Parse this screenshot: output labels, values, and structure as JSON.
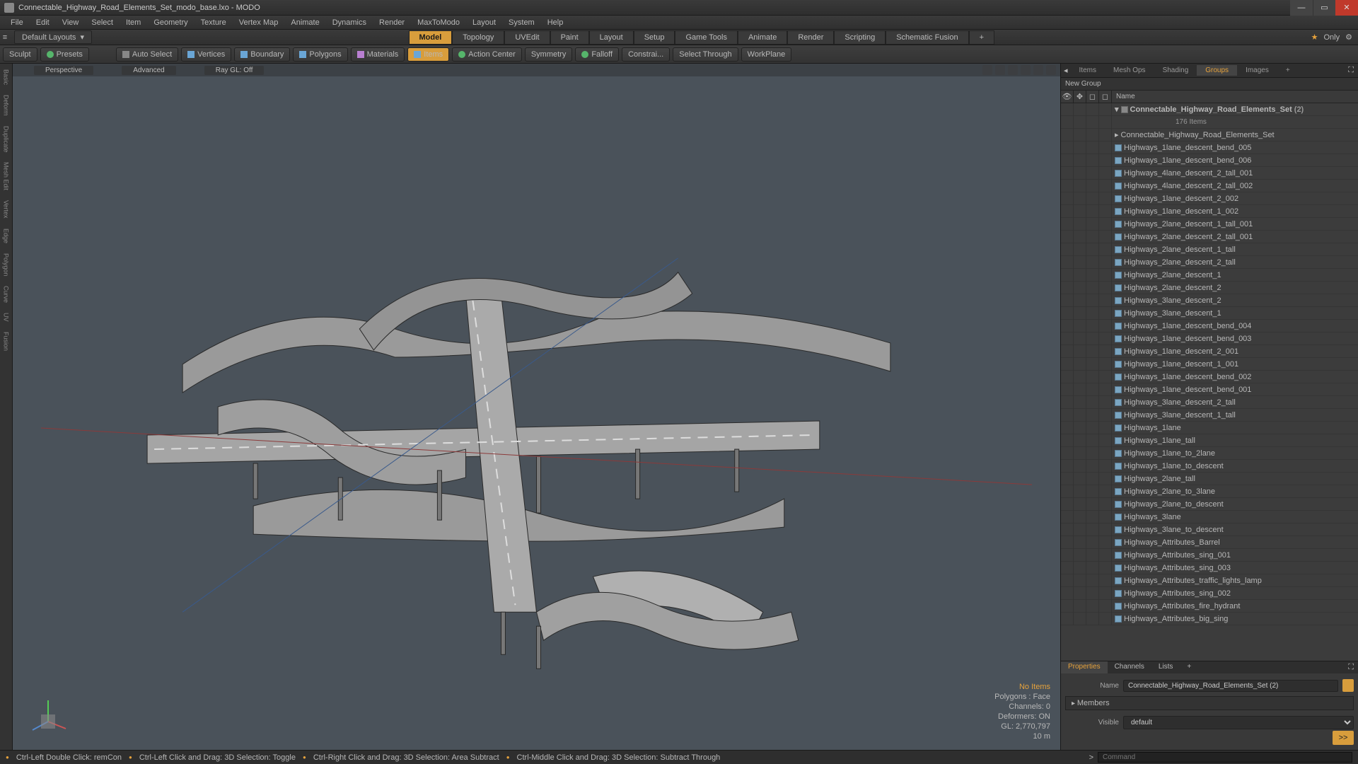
{
  "window": {
    "title": "Connectable_Highway_Road_Elements_Set_modo_base.lxo - MODO"
  },
  "menu": [
    "File",
    "Edit",
    "View",
    "Select",
    "Item",
    "Geometry",
    "Texture",
    "Vertex Map",
    "Animate",
    "Dynamics",
    "Render",
    "MaxToModo",
    "Layout",
    "System",
    "Help"
  ],
  "layoutbar": {
    "layouts": "Default Layouts",
    "tabs": [
      "Model",
      "Topology",
      "UVEdit",
      "Paint",
      "Layout",
      "Setup",
      "Game Tools",
      "Animate",
      "Render",
      "Scripting",
      "Schematic Fusion"
    ],
    "active_tab": "Model",
    "only": "Only"
  },
  "toolbar": {
    "sculpt": "Sculpt",
    "presets": "Presets",
    "autoselect": "Auto Select",
    "vertices": "Vertices",
    "boundary": "Boundary",
    "polygons": "Polygons",
    "materials": "Materials",
    "items": "Items",
    "actioncenter": "Action Center",
    "symmetry": "Symmetry",
    "falloff": "Falloff",
    "constraint": "Constrai...",
    "selectthrough": "Select Through",
    "workplane": "WorkPlane"
  },
  "viewport": {
    "top": [
      "Perspective",
      "Advanced",
      "Ray GL: Off"
    ],
    "stats": {
      "noitems": "No Items",
      "polygons": "Polygons : Face",
      "channels": "Channels: 0",
      "deformers": "Deformers: ON",
      "gl": "GL: 2,770,797",
      "grid": "10 m"
    }
  },
  "sidebar_vert": [
    "Basic",
    "Deform",
    "Duplicate",
    "Mesh Edit",
    "Vertex",
    "Edge",
    "Polygon",
    "Curve",
    "UV",
    "Fusion"
  ],
  "rp": {
    "tabs": [
      "Items",
      "Mesh Ops",
      "Shading",
      "Groups",
      "Images"
    ],
    "active": "Groups",
    "newgroup": "New Group",
    "colname": "Name",
    "root": "Connectable_Highway_Road_Elements_Set",
    "root_suffix": "(2)",
    "count": "176 Items",
    "folder": "Connectable_Highway_Road_Elements_Set",
    "items": [
      "Highways_1lane_descent_bend_005",
      "Highways_1lane_descent_bend_006",
      "Highways_4lane_descent_2_tall_001",
      "Highways_4lane_descent_2_tall_002",
      "Highways_1lane_descent_2_002",
      "Highways_1lane_descent_1_002",
      "Highways_2lane_descent_1_tall_001",
      "Highways_2lane_descent_2_tall_001",
      "Highways_2lane_descent_1_tall",
      "Highways_2lane_descent_2_tall",
      "Highways_2lane_descent_1",
      "Highways_2lane_descent_2",
      "Highways_3lane_descent_2",
      "Highways_3lane_descent_1",
      "Highways_1lane_descent_bend_004",
      "Highways_1lane_descent_bend_003",
      "Highways_1lane_descent_2_001",
      "Highways_1lane_descent_1_001",
      "Highways_1lane_descent_bend_002",
      "Highways_1lane_descent_bend_001",
      "Highways_3lane_descent_2_tall",
      "Highways_3lane_descent_1_tall",
      "Highways_1lane",
      "Highways_1lane_tall",
      "Highways_1lane_to_2lane",
      "Highways_1lane_to_descent",
      "Highways_2lane_tall",
      "Highways_2lane_to_3lane",
      "Highways_2lane_to_descent",
      "Highways_3lane",
      "Highways_3lane_to_descent",
      "Highways_Attributes_Barrel",
      "Highways_Attributes_sing_001",
      "Highways_Attributes_sing_003",
      "Highways_Attributes_traffic_lights_lamp",
      "Highways_Attributes_sing_002",
      "Highways_Attributes_fire_hydrant",
      "Highways_Attributes_big_sing"
    ]
  },
  "props": {
    "tabs": [
      "Properties",
      "Channels",
      "Lists"
    ],
    "name_label": "Name",
    "name_value": "Connectable_Highway_Road_Elements_Set (2)",
    "members": "Members",
    "visible_label": "Visible",
    "visible_value": "default"
  },
  "status": {
    "hints": [
      "Ctrl-Left Double Click: remCon",
      "Ctrl-Left Click and Drag: 3D Selection: Toggle",
      "Ctrl-Right Click and Drag: 3D Selection: Area Subtract",
      "Ctrl-Middle Click and Drag: 3D Selection: Subtract Through"
    ],
    "cmd": "Command"
  }
}
